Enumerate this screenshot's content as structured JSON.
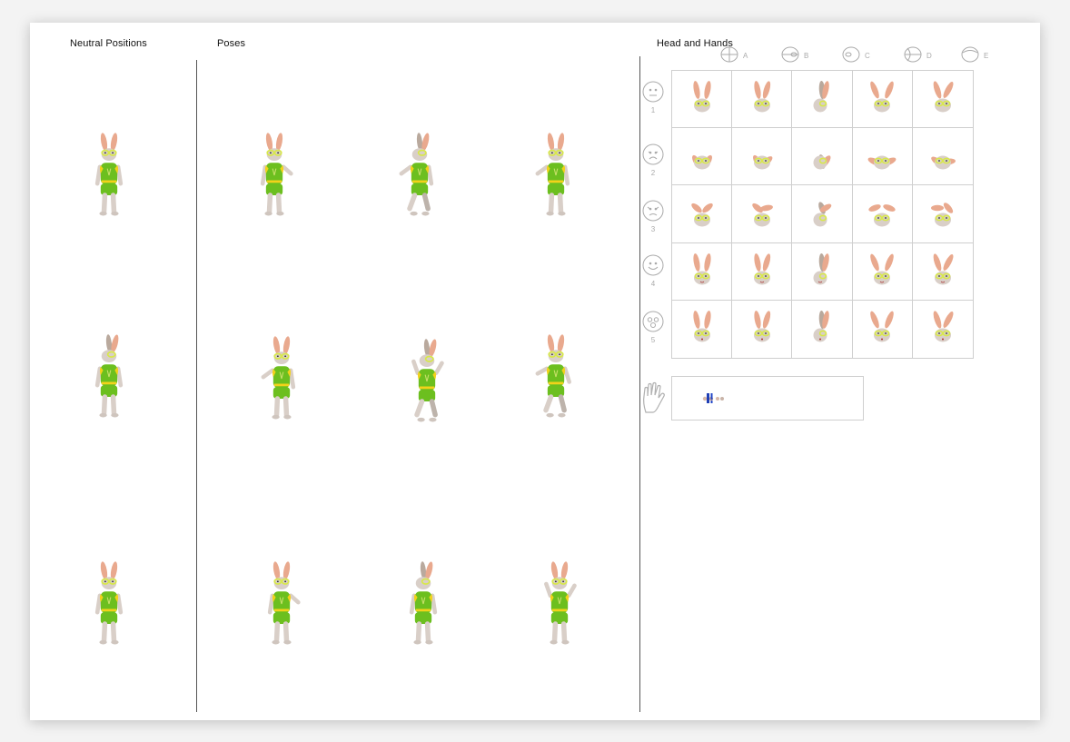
{
  "sections": {
    "neutral": "Neutral Positions",
    "poses": "Poses",
    "head_hands": "Head and Hands"
  },
  "columns": [
    "A",
    "B",
    "C",
    "D",
    "E"
  ],
  "rows": [
    "1",
    "2",
    "3",
    "4",
    "5"
  ],
  "icons": {
    "column_heads": [
      "head-front-icon",
      "head-side-icon",
      "head-profile-icon",
      "head-three-quarter-icon",
      "head-back-icon"
    ],
    "row_expressions": [
      "neutral-face-icon",
      "sad-face-icon",
      "angry-face-icon",
      "happy-face-icon",
      "surprised-face-icon"
    ],
    "hands": "hand-icon"
  },
  "colors": {
    "outfit": "#6cbf1f",
    "outfit_trim": "#f2d21a",
    "fur": "#d9cfc8",
    "ear_inner": "#e9a98e",
    "glasses": "#d8e84a"
  }
}
